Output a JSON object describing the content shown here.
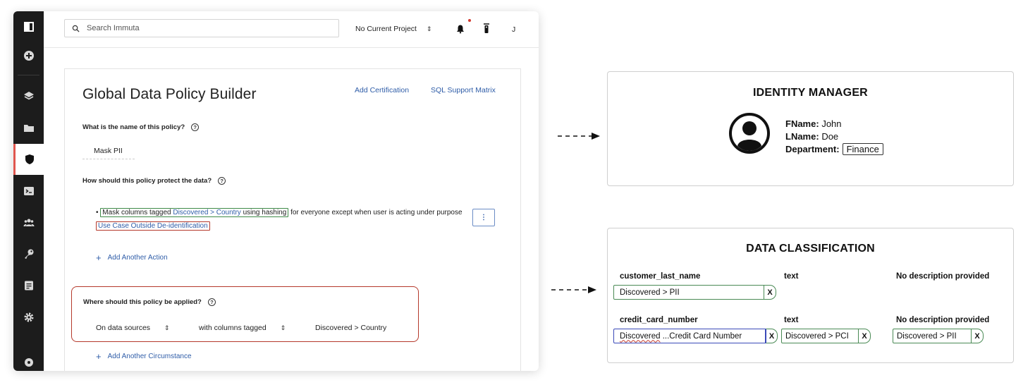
{
  "topbar": {
    "search_placeholder": "Search Immuta",
    "project": "No Current Project",
    "user_initial": "J"
  },
  "sidebar": {
    "items": [
      "panel-toggle-icon",
      "add-icon",
      "layers-icon",
      "folder-icon",
      "shield-icon",
      "terminal-icon",
      "users-icon",
      "key-icon",
      "document-icon",
      "gear-icon",
      "help-icon"
    ],
    "active": "shield-icon"
  },
  "policy": {
    "title": "Global Data Policy Builder",
    "links": [
      "Add Certification",
      "SQL Support Matrix"
    ],
    "name_question": "What is the name of this policy?",
    "name_value": "Mask PII",
    "protect_question": "How should this policy protect the data?",
    "action": {
      "bullet": "•",
      "mask_prefix": "Mask columns tagged ",
      "mask_tag": "Discovered > Country",
      "mask_suffix": " using hashing",
      "middle": " for everyone except when user is acting under purpose ",
      "purpose": "Use Case Outside De-identification"
    },
    "kebab": "⋮",
    "add_action": "Add Another Action",
    "where_question": "Where should this policy be applied?",
    "where_selects": [
      "On data sources",
      "with columns tagged",
      "Discovered > Country"
    ],
    "add_circumstance": "Add Another Circumstance"
  },
  "identity_manager": {
    "title": "IDENTITY MANAGER",
    "fname_label": "FName:",
    "fname": "John",
    "lname_label": "LName:",
    "lname": "Doe",
    "dept_label": "Department:",
    "dept": "Finance"
  },
  "data_classification": {
    "title": "DATA CLASSIFICATION",
    "rows": [
      {
        "column": "customer_last_name",
        "type": "text",
        "description": "No description provided",
        "tags": [
          "Discovered > PII"
        ]
      },
      {
        "column": "credit_card_number",
        "type": "text",
        "description": "No description provided",
        "tags": [
          "Discovered ...Credit Card Number",
          "Discovered > PCI",
          "Discovered > PII"
        ]
      }
    ],
    "remove_label": "X"
  },
  "colors": {
    "accent_red": "#e0574f",
    "link_blue": "#2f5da8",
    "green_border": "#3e8a48",
    "red_border": "#b5392b",
    "tag_blue": "#3a49b8"
  }
}
